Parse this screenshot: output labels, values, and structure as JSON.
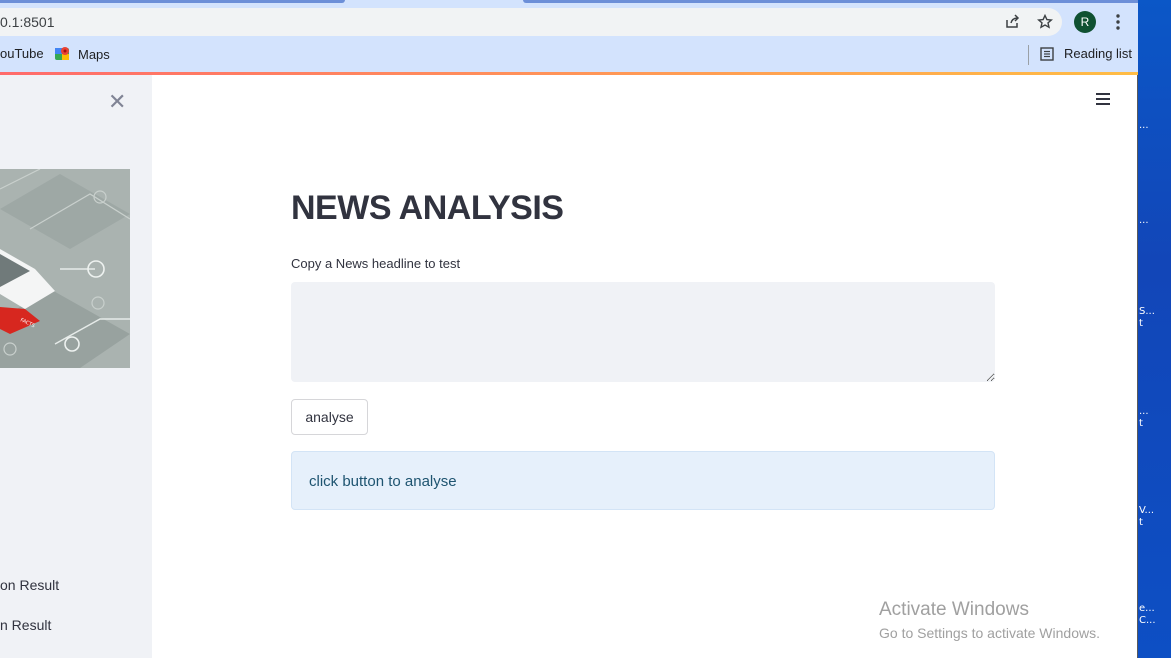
{
  "browser": {
    "url": "0.1:8501",
    "profile_initial": "R",
    "bookmarks": [
      {
        "label": "ouTube",
        "icon": "youtube-icon"
      },
      {
        "label": "Maps",
        "icon": "maps-icon"
      }
    ],
    "reading_list": "Reading list"
  },
  "sidebar": {
    "links": [
      "on Result",
      "n Result"
    ]
  },
  "main": {
    "title": "NEWS ANALYSIS",
    "input_label": "Copy a News headline to test",
    "input_value": "",
    "button_label": "analyse",
    "info_message": "click button to analyse"
  },
  "watermark": {
    "line1": "Activate Windows",
    "line2": "Go to Settings to activate Windows."
  },
  "desktop": {
    "icon_labels": [
      "...",
      "...",
      "S...\nt",
      "...\nt",
      "V...\nt",
      "e...\nC..."
    ]
  }
}
